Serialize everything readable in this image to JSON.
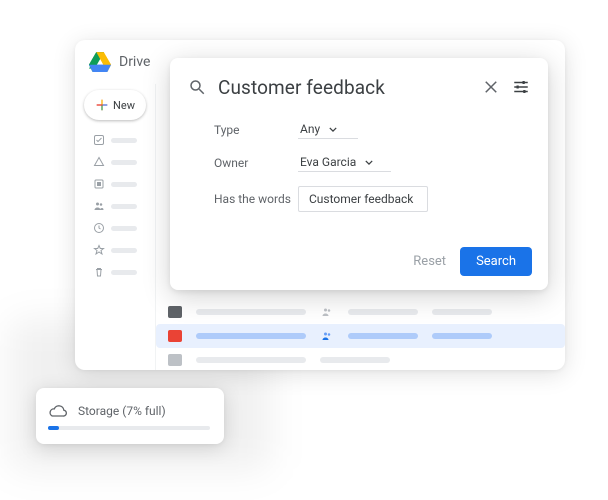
{
  "app": {
    "name": "Drive"
  },
  "sidebar": {
    "new_label": "New",
    "items": [
      {
        "id": "priority"
      },
      {
        "id": "my-drive"
      },
      {
        "id": "shared-drives"
      },
      {
        "id": "shared-with-me"
      },
      {
        "id": "recent"
      },
      {
        "id": "starred"
      },
      {
        "id": "trash"
      }
    ]
  },
  "search": {
    "query": "Customer feedback",
    "filters": {
      "type_label": "Type",
      "type_value": "Any",
      "owner_label": "Owner",
      "owner_value": "Eva Garcia",
      "words_label": "Has the words",
      "words_value": "Customer feedback"
    },
    "actions": {
      "reset": "Reset",
      "search": "Search"
    }
  },
  "storage": {
    "label": "Storage (7% full)",
    "percent": 7
  }
}
